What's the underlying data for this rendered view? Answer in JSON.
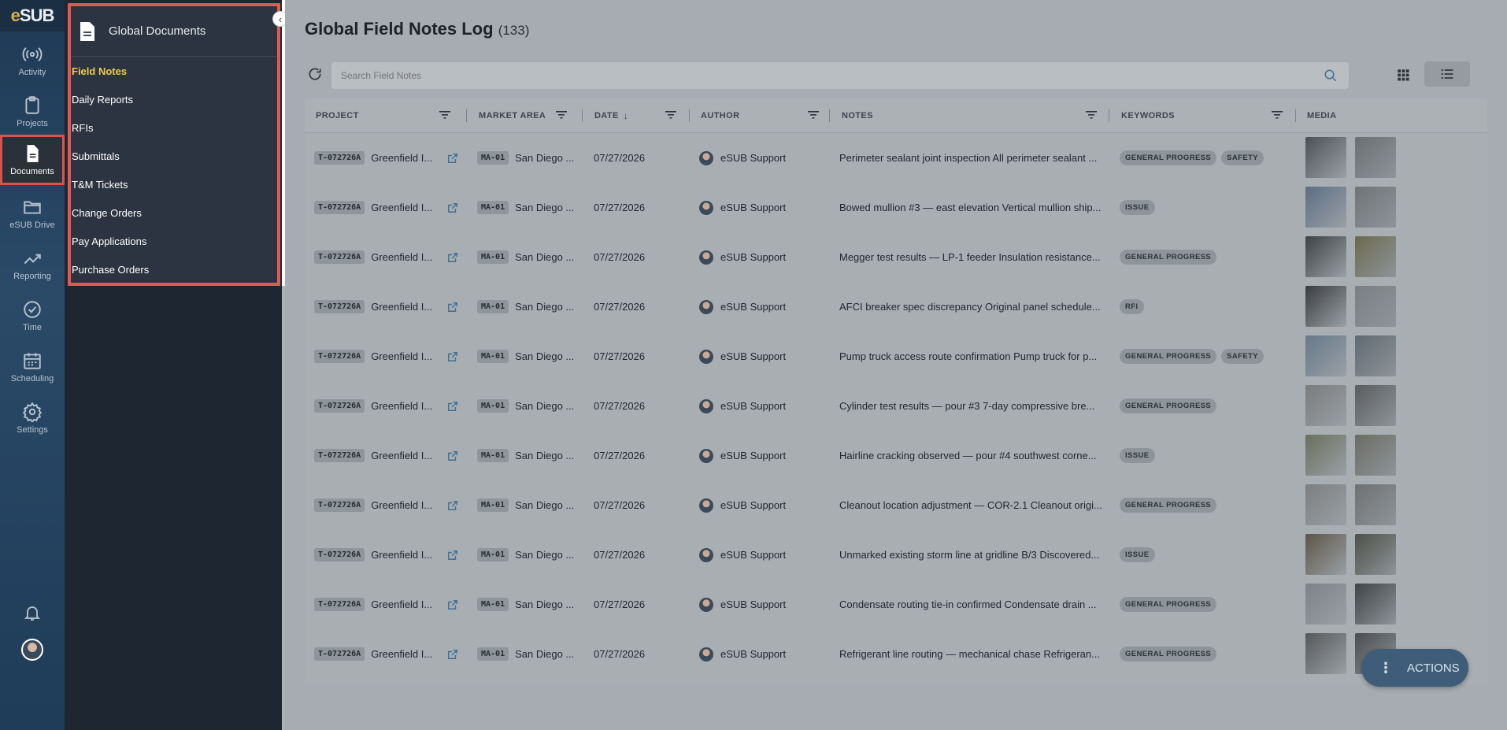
{
  "brand": {
    "logo_e": "e",
    "logo_text": "SUB"
  },
  "rail": {
    "items": [
      {
        "label": "Activity",
        "icon": "activity-icon"
      },
      {
        "label": "Projects",
        "icon": "clipboard-icon"
      },
      {
        "label": "Documents",
        "icon": "document-icon"
      },
      {
        "label": "eSUB Drive",
        "icon": "folder-icon"
      },
      {
        "label": "Reporting",
        "icon": "chart-icon"
      },
      {
        "label": "Time",
        "icon": "clock-icon"
      },
      {
        "label": "Scheduling",
        "icon": "calendar-icon"
      },
      {
        "label": "Settings",
        "icon": "gear-icon"
      }
    ]
  },
  "subpanel": {
    "title": "Global Documents",
    "items": [
      "Field Notes",
      "Daily Reports",
      "RFIs",
      "Submittals",
      "T&M Tickets",
      "Change Orders",
      "Pay Applications",
      "Purchase Orders"
    ]
  },
  "page": {
    "title": "Global Field Notes Log",
    "count": "(133)"
  },
  "search": {
    "placeholder": "Search Field Notes"
  },
  "columns": [
    "PROJECT",
    "MARKET AREA",
    "DATE",
    "AUTHOR",
    "NOTES",
    "KEYWORDS",
    "MEDIA"
  ],
  "rows": [
    {
      "project_code": "T-072726A",
      "project": "Greenfield I...",
      "market_code": "MA-01",
      "market": "San Diego ...",
      "date": "07/27/2026",
      "author": "eSUB Support",
      "notes": "Perimeter sealant joint inspection All perimeter sealant ...",
      "tags": [
        "GENERAL PROGRESS",
        "SAFETY"
      ]
    },
    {
      "project_code": "T-072726A",
      "project": "Greenfield I...",
      "market_code": "MA-01",
      "market": "San Diego ...",
      "date": "07/27/2026",
      "author": "eSUB Support",
      "notes": "Bowed mullion #3 — east elevation Vertical mullion ship...",
      "tags": [
        "ISSUE"
      ]
    },
    {
      "project_code": "T-072726A",
      "project": "Greenfield I...",
      "market_code": "MA-01",
      "market": "San Diego ...",
      "date": "07/27/2026",
      "author": "eSUB Support",
      "notes": "Megger test results — LP-1 feeder Insulation resistance...",
      "tags": [
        "GENERAL PROGRESS"
      ]
    },
    {
      "project_code": "T-072726A",
      "project": "Greenfield I...",
      "market_code": "MA-01",
      "market": "San Diego ...",
      "date": "07/27/2026",
      "author": "eSUB Support",
      "notes": "AFCI breaker spec discrepancy Original panel schedule...",
      "tags": [
        "RFI"
      ]
    },
    {
      "project_code": "T-072726A",
      "project": "Greenfield I...",
      "market_code": "MA-01",
      "market": "San Diego ...",
      "date": "07/27/2026",
      "author": "eSUB Support",
      "notes": "Pump truck access route confirmation Pump truck for p...",
      "tags": [
        "GENERAL PROGRESS",
        "SAFETY"
      ]
    },
    {
      "project_code": "T-072726A",
      "project": "Greenfield I...",
      "market_code": "MA-01",
      "market": "San Diego ...",
      "date": "07/27/2026",
      "author": "eSUB Support",
      "notes": "Cylinder test results — pour #3 7-day compressive bre...",
      "tags": [
        "GENERAL PROGRESS"
      ]
    },
    {
      "project_code": "T-072726A",
      "project": "Greenfield I...",
      "market_code": "MA-01",
      "market": "San Diego ...",
      "date": "07/27/2026",
      "author": "eSUB Support",
      "notes": "Hairline cracking observed — pour #4 southwest corne...",
      "tags": [
        "ISSUE"
      ]
    },
    {
      "project_code": "T-072726A",
      "project": "Greenfield I...",
      "market_code": "MA-01",
      "market": "San Diego ...",
      "date": "07/27/2026",
      "author": "eSUB Support",
      "notes": "Cleanout location adjustment — COR-2.1 Cleanout origi...",
      "tags": [
        "GENERAL PROGRESS"
      ]
    },
    {
      "project_code": "T-072726A",
      "project": "Greenfield I...",
      "market_code": "MA-01",
      "market": "San Diego ...",
      "date": "07/27/2026",
      "author": "eSUB Support",
      "notes": "Unmarked existing storm line at gridline B/3 Discovered...",
      "tags": [
        "ISSUE"
      ]
    },
    {
      "project_code": "T-072726A",
      "project": "Greenfield I...",
      "market_code": "MA-01",
      "market": "San Diego ...",
      "date": "07/27/2026",
      "author": "eSUB Support",
      "notes": "Condensate routing tie-in confirmed Condensate drain ...",
      "tags": [
        "GENERAL PROGRESS"
      ]
    },
    {
      "project_code": "T-072726A",
      "project": "Greenfield I...",
      "market_code": "MA-01",
      "market": "San Diego ...",
      "date": "07/27/2026",
      "author": "eSUB Support",
      "notes": "Refrigerant line routing — mechanical chase Refrigeran...",
      "tags": [
        "GENERAL PROGRESS"
      ]
    }
  ],
  "actions_label": "ACTIONS",
  "colors": {
    "accent_active": "#f2c94c",
    "highlight_border": "#e05a54"
  }
}
